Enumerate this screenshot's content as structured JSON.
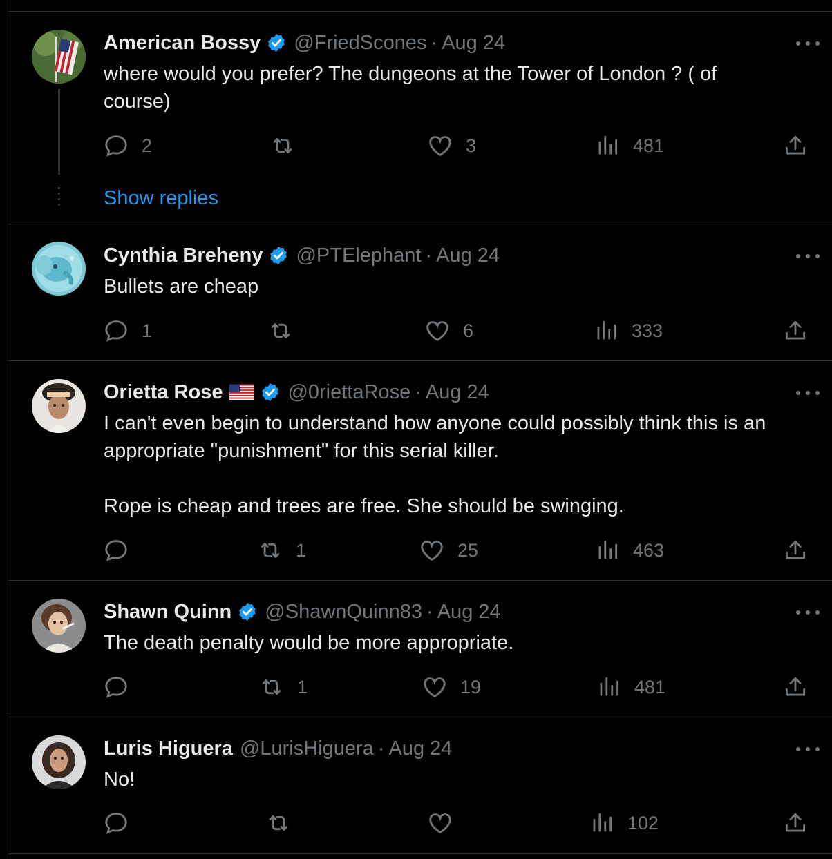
{
  "tweets": [
    {
      "name": "American Bossy",
      "handle": "@FriedScones",
      "sep": "·",
      "date": "Aug 24",
      "text": "where would you prefer? The dungeons at the Tower of London ? ( of\ncourse)",
      "replies": "2",
      "retweets": "",
      "likes": "3",
      "views": "481",
      "show_replies": "Show replies"
    },
    {
      "name": "Cynthia Breheny",
      "handle": "@PTElephant",
      "sep": "·",
      "date": "Aug 24",
      "text": "Bullets are cheap",
      "replies": "1",
      "retweets": "",
      "likes": "6",
      "views": "333"
    },
    {
      "name": "Orietta Rose",
      "handle": "@0riettaRose",
      "sep": "·",
      "date": "Aug 24",
      "text": "I can't even begin to understand how anyone could possibly think this is an\nappropriate \"punishment\" for this serial killer.\n\nRope is cheap and trees are free. She should be swinging.",
      "replies": "",
      "retweets": "1",
      "likes": "25",
      "views": "463"
    },
    {
      "name": "Shawn Quinn",
      "handle": "@ShawnQuinn83",
      "sep": "·",
      "date": "Aug 24",
      "text": "The death penalty would be more appropriate.",
      "replies": "",
      "retweets": "1",
      "likes": "19",
      "views": "481"
    },
    {
      "name": "Luris Higuera",
      "handle": "@LurisHiguera",
      "sep": "·",
      "date": "Aug 24",
      "text": "No!",
      "replies": "",
      "retweets": "",
      "likes": "",
      "views": "102"
    }
  ],
  "colors": {
    "background": "#000000",
    "text": "#e7e9ea",
    "muted": "#71767b",
    "link": "#1d9bf0",
    "verified": "#1d9bf0",
    "divider": "#2f3336"
  },
  "icons": [
    "reply-icon",
    "retweet-icon",
    "like-icon",
    "views-icon",
    "share-icon",
    "more-icon",
    "verified-badge-icon",
    "us-flag-icon"
  ]
}
